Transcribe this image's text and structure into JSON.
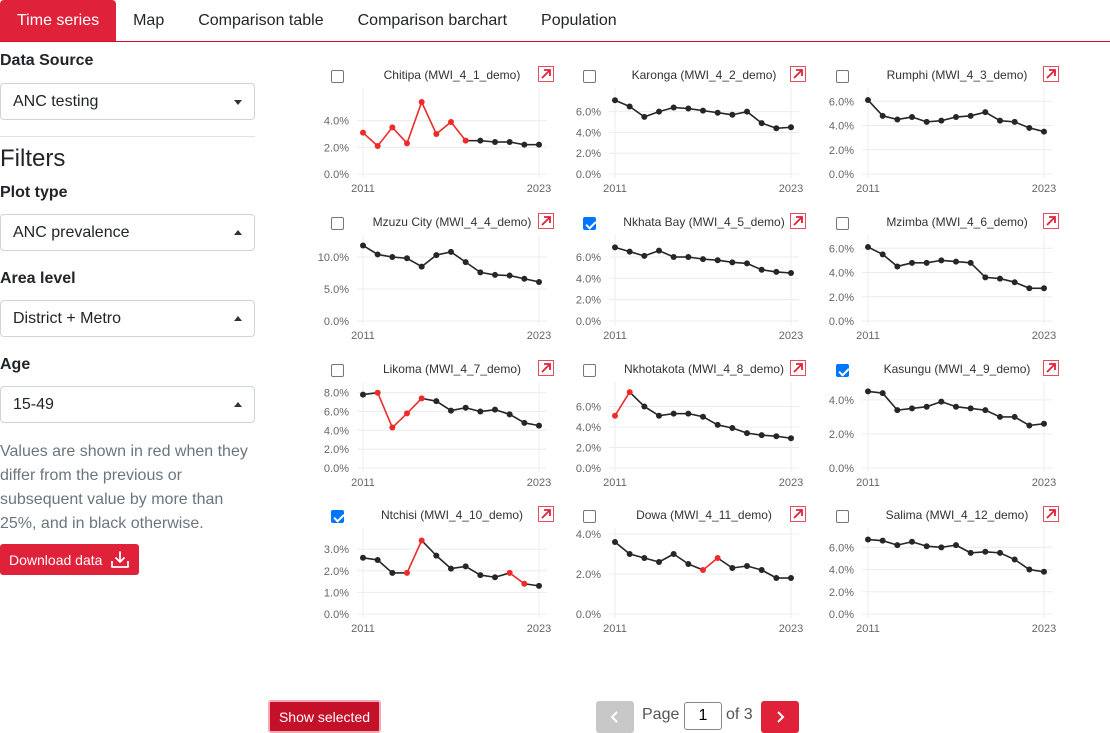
{
  "tabs": [
    "Time series",
    "Map",
    "Comparison table",
    "Comparison barchart",
    "Population"
  ],
  "sidebar": {
    "data_source_label": "Data Source",
    "data_source_value": "ANC testing",
    "filters_title": "Filters",
    "plot_type_label": "Plot type",
    "plot_type_value": "ANC prevalence",
    "area_level_label": "Area level",
    "area_level_value": "District + Metro",
    "age_label": "Age",
    "age_value": "15-49",
    "help_text": "Values are shown in red when they differ from the previous or subsequent value by more than 25%, and in black otherwise.",
    "download_label": "Download data"
  },
  "colors": {
    "accent": "#e0213a",
    "point_normal": "#262626",
    "point_flag": "#ee2b2b",
    "checkbox": "#0075ff"
  },
  "icons": {
    "download": "download-icon",
    "open_external": "arrow-up-right-icon",
    "prev": "chevron-left-icon",
    "next": "chevron-right-icon"
  },
  "plots": [
    {
      "title": "Chitipa (MWI_4_1_demo)",
      "checked": false,
      "x_start": "2011",
      "x_end": "2023",
      "yticks": [
        "0.0%",
        "2.0%",
        "4.0%"
      ],
      "ymax": 0.06,
      "values": [
        0.031,
        0.021,
        0.035,
        0.023,
        0.054,
        0.03,
        0.039,
        0.025,
        0.025,
        0.024,
        0.024,
        0.022,
        0.022
      ],
      "flags": [
        1,
        1,
        1,
        1,
        1,
        1,
        1,
        1,
        0,
        0,
        0,
        0,
        0
      ]
    },
    {
      "title": "Karonga (MWI_4_2_demo)",
      "checked": false,
      "x_start": "2011",
      "x_end": "2023",
      "yticks": [
        "0.0%",
        "2.0%",
        "4.0%",
        "6.0%"
      ],
      "ymax": 0.077,
      "values": [
        0.071,
        0.065,
        0.055,
        0.06,
        0.064,
        0.063,
        0.061,
        0.059,
        0.057,
        0.06,
        0.049,
        0.044,
        0.045
      ],
      "flags": [
        0,
        0,
        0,
        0,
        0,
        0,
        0,
        0,
        0,
        0,
        0,
        0,
        0
      ]
    },
    {
      "title": "Rumphi (MWI_4_3_demo)",
      "checked": false,
      "x_start": "2011",
      "x_end": "2023",
      "yticks": [
        "0.0%",
        "2.0%",
        "4.0%",
        "6.0%"
      ],
      "ymax": 0.066,
      "values": [
        0.061,
        0.048,
        0.045,
        0.047,
        0.043,
        0.044,
        0.047,
        0.048,
        0.051,
        0.044,
        0.043,
        0.038,
        0.035
      ],
      "flags": [
        0,
        0,
        0,
        0,
        0,
        0,
        0,
        0,
        0,
        0,
        0,
        0,
        0
      ]
    },
    {
      "title": "Mzuzu City (MWI_4_4_demo)",
      "checked": false,
      "x_start": "2011",
      "x_end": "2023",
      "yticks": [
        "0.0%",
        "5.0%",
        "10.0%"
      ],
      "ymax": 0.125,
      "values": [
        0.118,
        0.104,
        0.1,
        0.098,
        0.085,
        0.103,
        0.108,
        0.092,
        0.076,
        0.072,
        0.071,
        0.066,
        0.061
      ],
      "flags": [
        0,
        0,
        0,
        0,
        0,
        0,
        0,
        0,
        0,
        0,
        0,
        0,
        0
      ]
    },
    {
      "title": "Nkhata Bay (MWI_4_5_demo)",
      "checked": true,
      "x_start": "2011",
      "x_end": "2023",
      "yticks": [
        "0.0%",
        "2.0%",
        "4.0%",
        "6.0%"
      ],
      "ymax": 0.075,
      "values": [
        0.069,
        0.065,
        0.061,
        0.066,
        0.06,
        0.06,
        0.058,
        0.057,
        0.055,
        0.054,
        0.048,
        0.046,
        0.045
      ],
      "flags": [
        0,
        0,
        0,
        0,
        0,
        0,
        0,
        0,
        0,
        0,
        0,
        0,
        0
      ]
    },
    {
      "title": "Mzimba (MWI_4_6_demo)",
      "checked": false,
      "x_start": "2011",
      "x_end": "2023",
      "yticks": [
        "0.0%",
        "2.0%",
        "4.0%",
        "6.0%"
      ],
      "ymax": 0.066,
      "values": [
        0.061,
        0.055,
        0.045,
        0.048,
        0.048,
        0.05,
        0.049,
        0.048,
        0.036,
        0.035,
        0.032,
        0.027,
        0.027
      ],
      "flags": [
        0,
        0,
        0,
        0,
        0,
        0,
        0,
        0,
        0,
        0,
        0,
        0,
        0
      ]
    },
    {
      "title": "Likoma (MWI_4_7_demo)",
      "checked": false,
      "x_start": "2011",
      "x_end": "2023",
      "yticks": [
        "0.0%",
        "2.0%",
        "4.0%",
        "6.0%",
        "8.0%"
      ],
      "ymax": 0.085,
      "values": [
        0.078,
        0.08,
        0.043,
        0.058,
        0.074,
        0.071,
        0.061,
        0.064,
        0.06,
        0.062,
        0.057,
        0.048,
        0.045
      ],
      "flags": [
        0,
        1,
        1,
        1,
        1,
        0,
        0,
        0,
        0,
        0,
        0,
        0,
        0
      ]
    },
    {
      "title": "Nkhotakota (MWI_4_8_demo)",
      "checked": false,
      "x_start": "2011",
      "x_end": "2023",
      "yticks": [
        "0.0%",
        "2.0%",
        "4.0%",
        "6.0%"
      ],
      "ymax": 0.078,
      "values": [
        0.051,
        0.074,
        0.06,
        0.051,
        0.053,
        0.053,
        0.05,
        0.042,
        0.039,
        0.034,
        0.032,
        0.031,
        0.029
      ],
      "flags": [
        1,
        1,
        0,
        0,
        0,
        0,
        0,
        0,
        0,
        0,
        0,
        0,
        0
      ]
    },
    {
      "title": "Kasungu (MWI_4_9_demo)",
      "checked": true,
      "x_start": "2011",
      "x_end": "2023",
      "yticks": [
        "0.0%",
        "2.0%",
        "4.0%"
      ],
      "ymax": 0.047,
      "values": [
        0.045,
        0.044,
        0.034,
        0.035,
        0.036,
        0.039,
        0.036,
        0.035,
        0.034,
        0.03,
        0.03,
        0.025,
        0.026
      ],
      "flags": [
        0,
        0,
        0,
        0,
        0,
        0,
        0,
        0,
        0,
        0,
        0,
        0,
        0
      ]
    },
    {
      "title": "Ntchisi (MWI_4_10_demo)",
      "checked": true,
      "x_start": "2011",
      "x_end": "2023",
      "yticks": [
        "0.0%",
        "1.0%",
        "2.0%",
        "3.0%"
      ],
      "ymax": 0.037,
      "values": [
        0.026,
        0.025,
        0.019,
        0.019,
        0.034,
        0.027,
        0.021,
        0.022,
        0.018,
        0.017,
        0.019,
        0.014,
        0.013
      ],
      "flags": [
        0,
        0,
        0,
        1,
        1,
        0,
        0,
        0,
        0,
        0,
        1,
        1,
        0
      ]
    },
    {
      "title": "Dowa (MWI_4_11_demo)",
      "checked": false,
      "x_start": "2011",
      "x_end": "2023",
      "yticks": [
        "0.0%",
        "2.0%",
        "4.0%"
      ],
      "ymax": 0.04,
      "values": [
        0.036,
        0.03,
        0.028,
        0.026,
        0.03,
        0.025,
        0.022,
        0.028,
        0.023,
        0.024,
        0.022,
        0.018,
        0.018
      ],
      "flags": [
        0,
        0,
        0,
        0,
        0,
        0,
        1,
        1,
        0,
        0,
        0,
        0,
        0
      ]
    },
    {
      "title": "Salima (MWI_4_12_demo)",
      "checked": false,
      "x_start": "2011",
      "x_end": "2023",
      "yticks": [
        "0.0%",
        "2.0%",
        "4.0%",
        "6.0%"
      ],
      "ymax": 0.072,
      "values": [
        0.067,
        0.066,
        0.062,
        0.065,
        0.061,
        0.06,
        0.062,
        0.055,
        0.056,
        0.055,
        0.049,
        0.04,
        0.038
      ],
      "flags": [
        0,
        0,
        0,
        0,
        0,
        0,
        0,
        0,
        0,
        0,
        0,
        0,
        0
      ]
    }
  ],
  "footer": {
    "show_selected_label": "Show selected",
    "page_label": "Page",
    "page_value": "1",
    "of_label": "of 3"
  }
}
